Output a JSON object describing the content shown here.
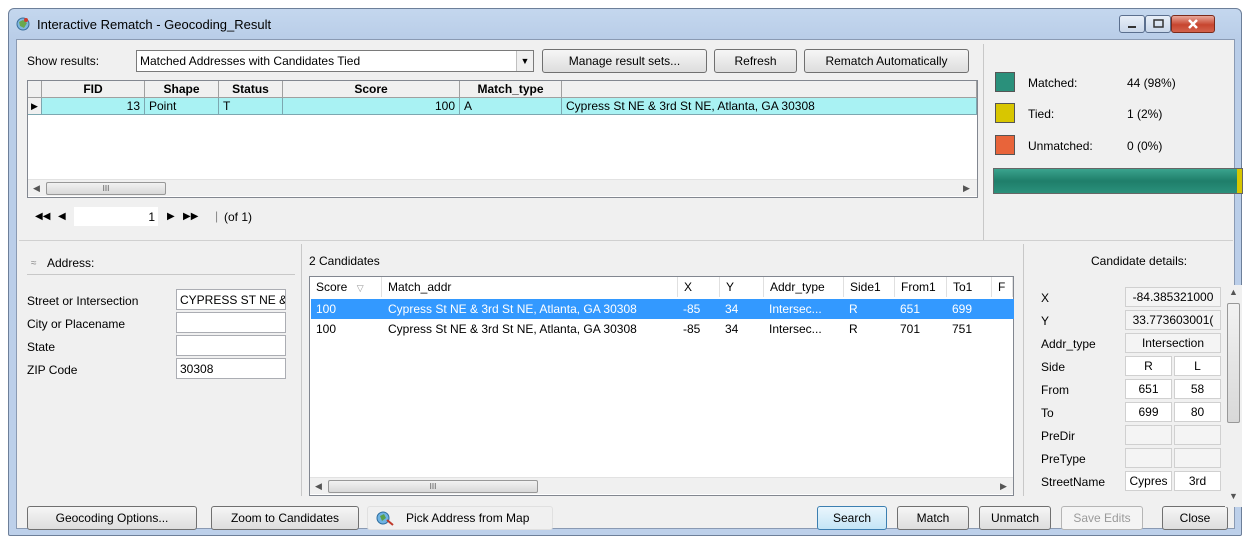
{
  "window": {
    "title": "Interactive Rematch - Geocoding_Result"
  },
  "toolbar": {
    "show_results_label": "Show results:",
    "result_set": "Matched Addresses with Candidates Tied",
    "manage_label": "Manage result sets...",
    "refresh_label": "Refresh",
    "rematch_label": "Rematch Automatically"
  },
  "results_table": {
    "columns": [
      "FID",
      "Shape",
      "Status",
      "Score",
      "Match_type",
      ""
    ],
    "row": {
      "fid": "13",
      "shape": "Point",
      "status": "T",
      "score": "100",
      "match_type": "A",
      "address": "Cypress St NE & 3rd St NE, Atlanta, GA 30308"
    }
  },
  "pager": {
    "current": "1",
    "total_text": "(of 1)"
  },
  "stats": {
    "matched_label": "Matched:",
    "matched_value": "44 (98%)",
    "tied_label": "Tied:",
    "tied_value": "1 (2%)",
    "unmatched_label": "Unmatched:",
    "unmatched_value": "0 (0%)",
    "matched_fraction": 0.98,
    "tied_fraction": 0.02,
    "colors": {
      "matched": "#2a907b",
      "tied": "#d8c600",
      "unmatched": "#e8643a"
    }
  },
  "address": {
    "header": "Address:",
    "fields": [
      {
        "label": "Street or Intersection",
        "value": "CYPRESS ST NE &"
      },
      {
        "label": "City or Placename",
        "value": ""
      },
      {
        "label": "State",
        "value": ""
      },
      {
        "label": "ZIP Code",
        "value": "30308"
      }
    ]
  },
  "candidates": {
    "count_label": "2 Candidates",
    "columns": [
      "Score",
      "Match_addr",
      "X",
      "Y",
      "Addr_type",
      "Side1",
      "From1",
      "To1",
      "F"
    ],
    "rows": [
      {
        "score": "100",
        "match_addr": "Cypress St NE & 3rd St NE, Atlanta, GA 30308",
        "x": "-85",
        "y": "34",
        "addr_type": "Intersec...",
        "side": "R",
        "from": "651",
        "to": "699"
      },
      {
        "score": "100",
        "match_addr": "Cypress St NE & 3rd St NE, Atlanta, GA 30308",
        "x": "-85",
        "y": "34",
        "addr_type": "Intersec...",
        "side": "R",
        "from": "701",
        "to": "751"
      }
    ]
  },
  "details": {
    "header": "Candidate details:",
    "x_label": "X",
    "x_value": "-84.385321000",
    "y_label": "Y",
    "y_value": "33.773603001(",
    "addr_type_label": "Addr_type",
    "addr_type_value": "Intersection",
    "side_label": "Side",
    "side_1": "R",
    "side_2": "L",
    "from_label": "From",
    "from_1": "651",
    "from_2": "58",
    "to_label": "To",
    "to_1": "699",
    "to_2": "80",
    "predir_label": "PreDir",
    "pretype_label": "PreType",
    "streetname_label": "StreetName",
    "streetname_1": "Cypres",
    "streetname_2": "3rd"
  },
  "bottom": {
    "geocoding_options": "Geocoding Options...",
    "zoom_candidates": "Zoom to Candidates",
    "pick_address": "Pick Address from Map",
    "search": "Search",
    "match": "Match",
    "unmatch": "Unmatch",
    "save_edits": "Save Edits",
    "close": "Close"
  },
  "scroll_glyph": "III"
}
